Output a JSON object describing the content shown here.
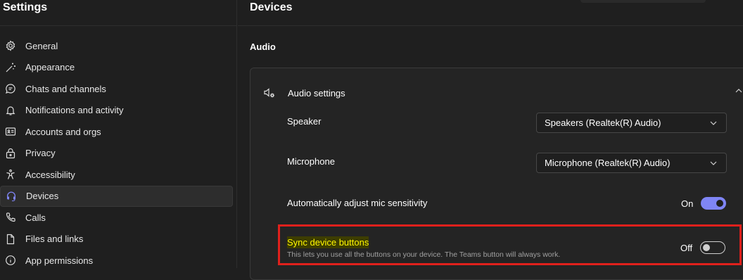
{
  "sidebar": {
    "title": "Settings",
    "items": [
      {
        "label": "General",
        "icon": "gear-icon"
      },
      {
        "label": "Appearance",
        "icon": "magic-wand-icon"
      },
      {
        "label": "Chats and channels",
        "icon": "chat-icon"
      },
      {
        "label": "Notifications and activity",
        "icon": "bell-icon"
      },
      {
        "label": "Accounts and orgs",
        "icon": "contact-card-icon"
      },
      {
        "label": "Privacy",
        "icon": "lock-icon"
      },
      {
        "label": "Accessibility",
        "icon": "accessibility-icon"
      },
      {
        "label": "Devices",
        "icon": "headset-icon",
        "active": true
      },
      {
        "label": "Calls",
        "icon": "phone-icon"
      },
      {
        "label": "Files and links",
        "icon": "document-icon"
      },
      {
        "label": "App permissions",
        "icon": "shield-icon"
      }
    ]
  },
  "main": {
    "title": "Devices",
    "section": "Audio",
    "card": {
      "title": "Audio settings",
      "speaker": {
        "label": "Speaker",
        "value": "Speakers (Realtek(R) Audio)"
      },
      "microphone": {
        "label": "Microphone",
        "value": "Microphone (Realtek(R) Audio)"
      },
      "auto_adjust": {
        "label": "Automatically adjust mic sensitivity",
        "state": "On"
      },
      "sync_buttons": {
        "label": "Sync device buttons",
        "description": "This lets you use all the buttons on your device. The Teams button will always work.",
        "state": "Off"
      }
    }
  },
  "colors": {
    "accent": "#7f85f5",
    "highlight_border": "#e0201c",
    "highlight_text": "#fff700"
  }
}
